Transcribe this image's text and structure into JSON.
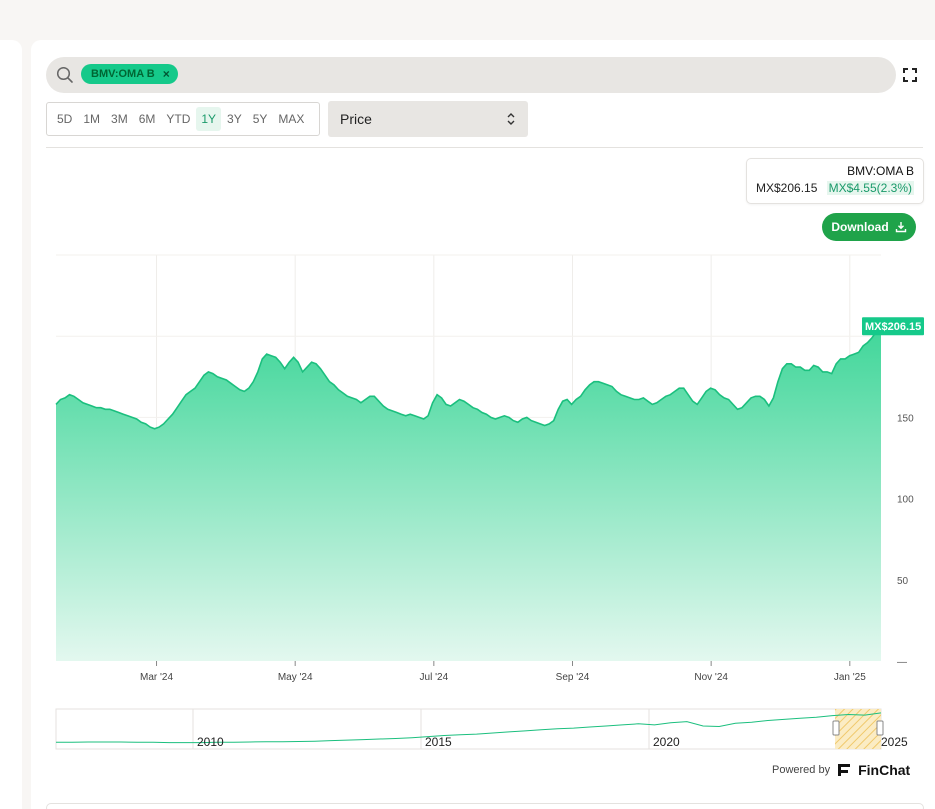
{
  "search": {
    "chip_label": "BMV:OMA B",
    "chip_close": "×"
  },
  "toolbar": {
    "ranges": [
      {
        "label": "5D",
        "active": false
      },
      {
        "label": "1M",
        "active": false
      },
      {
        "label": "3M",
        "active": false
      },
      {
        "label": "6M",
        "active": false
      },
      {
        "label": "YTD",
        "active": false
      },
      {
        "label": "1Y",
        "active": true
      },
      {
        "label": "3Y",
        "active": false
      },
      {
        "label": "5Y",
        "active": false
      },
      {
        "label": "MAX",
        "active": false
      }
    ],
    "metric_select": "Price"
  },
  "quote": {
    "symbol": "BMV:OMA B",
    "price": "MX$206.15",
    "change": "MX$4.55(2.3%)"
  },
  "download_label": "Download",
  "powered_by": {
    "text": "Powered by",
    "brand": "FinChat"
  },
  "colors": {
    "accent": "#15c98a",
    "download": "#1fa34a",
    "area_top": "#3fd699",
    "area_bottom": "#e3f8ef"
  },
  "chart_data": {
    "type": "area",
    "title": "",
    "xlabel": "",
    "ylabel": "",
    "x_ticks": [
      "Mar '24",
      "May '24",
      "Jul '24",
      "Sep '24",
      "Nov '24",
      "Jan '25"
    ],
    "y_ticks": [
      {
        "value": 0,
        "label": "—"
      },
      {
        "value": 50,
        "label": "50"
      },
      {
        "value": 100,
        "label": "100"
      },
      {
        "value": 150,
        "label": "150"
      }
    ],
    "ylim": [
      0,
      250
    ],
    "last_value_label": "MX$206.15",
    "series": [
      {
        "values": [
          158,
          161,
          162,
          164,
          163,
          161,
          159,
          158,
          157,
          156,
          156,
          155,
          155,
          154,
          153,
          152,
          151,
          150,
          149,
          147,
          146,
          144,
          143,
          144,
          146,
          149,
          152,
          156,
          160,
          164,
          166,
          168,
          172,
          176,
          178,
          177,
          175,
          174,
          173,
          171,
          169,
          167,
          166,
          168,
          172,
          178,
          186,
          189,
          188,
          187,
          184,
          180,
          184,
          187,
          184,
          178,
          181,
          184,
          183,
          180,
          176,
          172,
          170,
          167,
          165,
          163,
          162,
          161,
          159,
          161,
          163,
          163,
          160,
          157,
          155,
          154,
          153,
          152,
          151,
          152,
          151,
          150,
          149,
          151,
          159,
          164,
          162,
          158,
          157,
          159,
          161,
          160,
          158,
          156,
          155,
          153,
          152,
          150,
          149,
          150,
          151,
          150,
          148,
          147,
          149,
          150,
          148,
          147,
          146,
          145,
          146,
          148,
          155,
          160,
          161,
          158,
          161,
          163,
          167,
          170,
          172,
          172,
          171,
          170,
          169,
          166,
          164,
          163,
          162,
          161,
          161,
          162,
          160,
          158,
          159,
          161,
          163,
          164,
          166,
          168,
          168,
          164,
          160,
          158,
          162,
          166,
          168,
          167,
          164,
          162,
          161,
          158,
          155,
          156,
          159,
          162,
          163,
          163,
          161,
          157,
          162,
          172,
          180,
          183,
          183,
          181,
          181,
          179,
          179,
          182,
          181,
          178,
          178,
          177,
          183,
          186,
          186,
          188,
          189,
          190,
          194,
          196,
          199,
          203,
          206.15
        ],
        "xmin_month": 1.55,
        "xmax_month": 13.45
      }
    ],
    "navigator": {
      "x_labels": [
        "2010",
        "2015",
        "2020",
        "2025"
      ],
      "values": [
        10,
        10,
        11,
        11,
        11,
        10,
        10,
        9,
        9,
        9,
        10,
        10,
        11,
        12,
        12,
        13,
        14,
        16,
        18,
        20,
        22,
        24,
        27,
        31,
        35,
        38,
        40,
        44,
        48,
        52,
        56,
        60,
        62,
        66,
        70,
        74,
        78,
        74,
        82,
        86,
        70,
        68,
        80,
        84,
        90,
        94,
        98,
        102,
        108,
        112,
        110,
        118
      ]
    }
  }
}
